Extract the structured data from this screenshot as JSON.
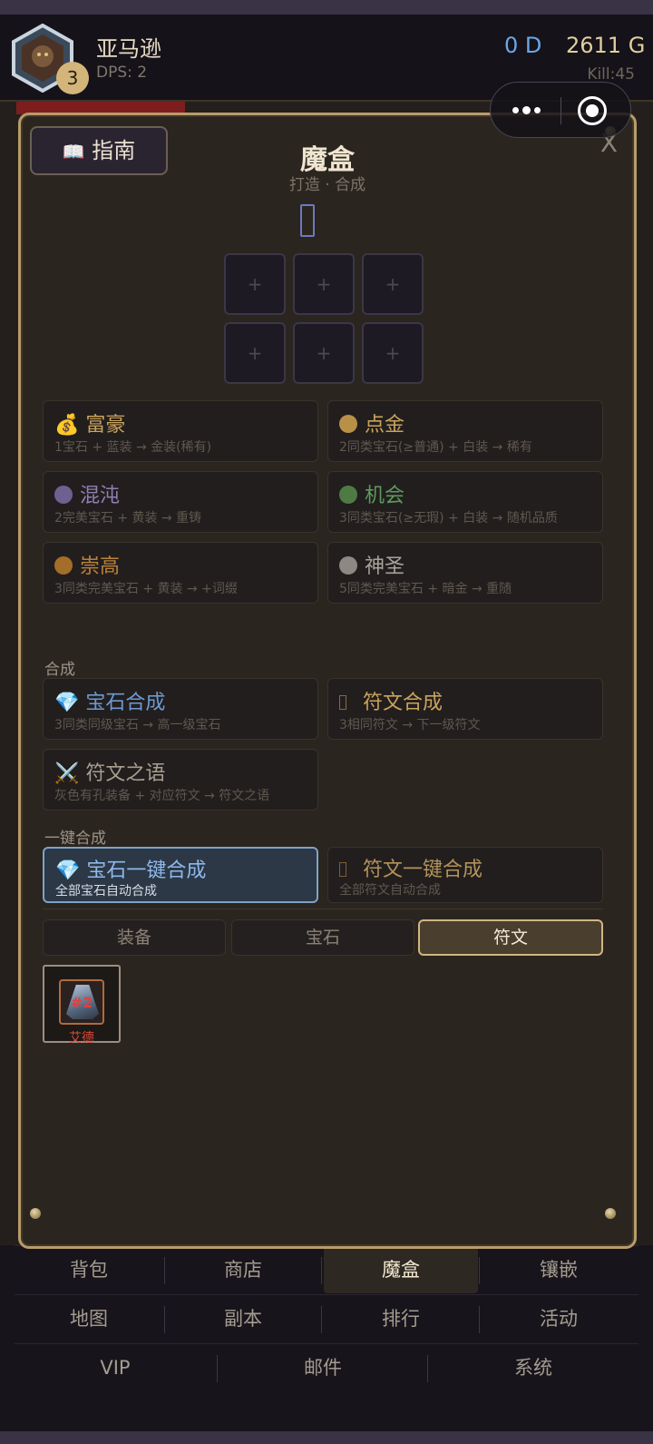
{
  "header": {
    "hero_name": "亚马逊",
    "level": "3",
    "dps": "DPS: 2",
    "currency_d": "0 D",
    "currency_g": "2611 G",
    "kill": "Kill:45"
  },
  "capsule": {
    "menu_icon": "more-dots-icon",
    "close_icon": "target-circle-icon"
  },
  "modal": {
    "guide_label": "指南",
    "guide_icon": "open-book-icon",
    "close_label": "X",
    "title": "魔盒",
    "subtitle": "打造 · 合成",
    "slot_label": "+",
    "recipes": [
      {
        "title": "富豪",
        "desc": "1宝石 + 蓝装 → 金装(稀有)",
        "icon": "money-bag-icon",
        "color": "#c9a45c"
      },
      {
        "title": "点金",
        "desc": "2同类宝石(≥普通) + 白装 → 稀有",
        "icon": "gold-dot-icon",
        "color": "#c9a45c"
      },
      {
        "title": "混沌",
        "desc": "2完美宝石 + 黄装 → 重铸",
        "icon": "purple-dot-icon",
        "color": "#8f7fb4"
      },
      {
        "title": "机会",
        "desc": "3同类宝石(≥无瑕) + 白装 → 随机品质",
        "icon": "green-dot-icon",
        "color": "#5e9a5e"
      },
      {
        "title": "崇高",
        "desc": "3同类完美宝石 + 黄装 → +词缀",
        "icon": "orange-dot-icon",
        "color": "#bb8238"
      },
      {
        "title": "神圣",
        "desc": "5同类完美宝石 + 暗金 → 重随",
        "icon": "white-dot-icon",
        "color": "#a8a29a"
      }
    ],
    "section_synth": "合成",
    "synth": [
      {
        "title": "宝石合成",
        "desc": "3同类同级宝石 → 高一级宝石",
        "icon": "diamond-icon",
        "color": "#6d9ad0"
      },
      {
        "title": "符文合成",
        "desc": "3相同符文 → 下一级符文",
        "icon": "rune-icon",
        "color": "#c9a45c"
      },
      {
        "title": "符文之语",
        "desc": "灰色有孔装备 + 对应符文 → 符文之语",
        "icon": "crossed-swords-icon",
        "color": "#a79e8e"
      }
    ],
    "section_oneclick": "一键合成",
    "oneclick": [
      {
        "title": "宝石一键合成",
        "desc": "全部宝石自动合成",
        "icon": "diamond-icon",
        "color": "#8fb8ea"
      },
      {
        "title": "符文一键合成",
        "desc": "全部符文自动合成",
        "icon": "rune-icon",
        "color": "#b2935a"
      }
    ],
    "tabs": [
      "装备",
      "宝石",
      "符文"
    ],
    "selected_tab": "符文",
    "inventory": [
      {
        "name": "艾德",
        "num": "#2"
      }
    ]
  },
  "nav": {
    "row1": [
      "背包",
      "商店",
      "魔盒",
      "镶嵌"
    ],
    "row2": [
      "地图",
      "副本",
      "排行",
      "活动"
    ],
    "row3": [
      "VIP",
      "邮件",
      "系统"
    ],
    "selected": "魔盒"
  }
}
